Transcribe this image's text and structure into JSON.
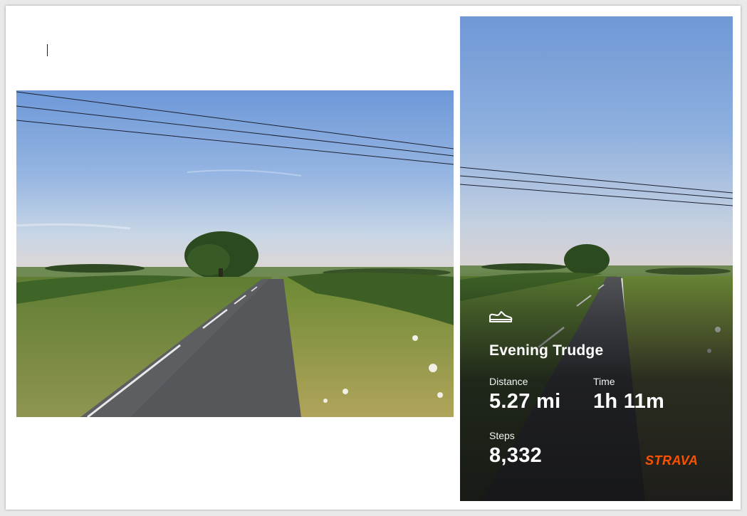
{
  "activity": {
    "title": "Evening Trudge",
    "icon": "shoe-icon",
    "distance_label": "Distance",
    "distance_value": "5.27 mi",
    "time_label": "Time",
    "time_value": "1h 11m",
    "steps_label": "Steps",
    "steps_value": "8,332"
  },
  "brand": {
    "name": "STRAVA",
    "color": "#fc5200"
  }
}
